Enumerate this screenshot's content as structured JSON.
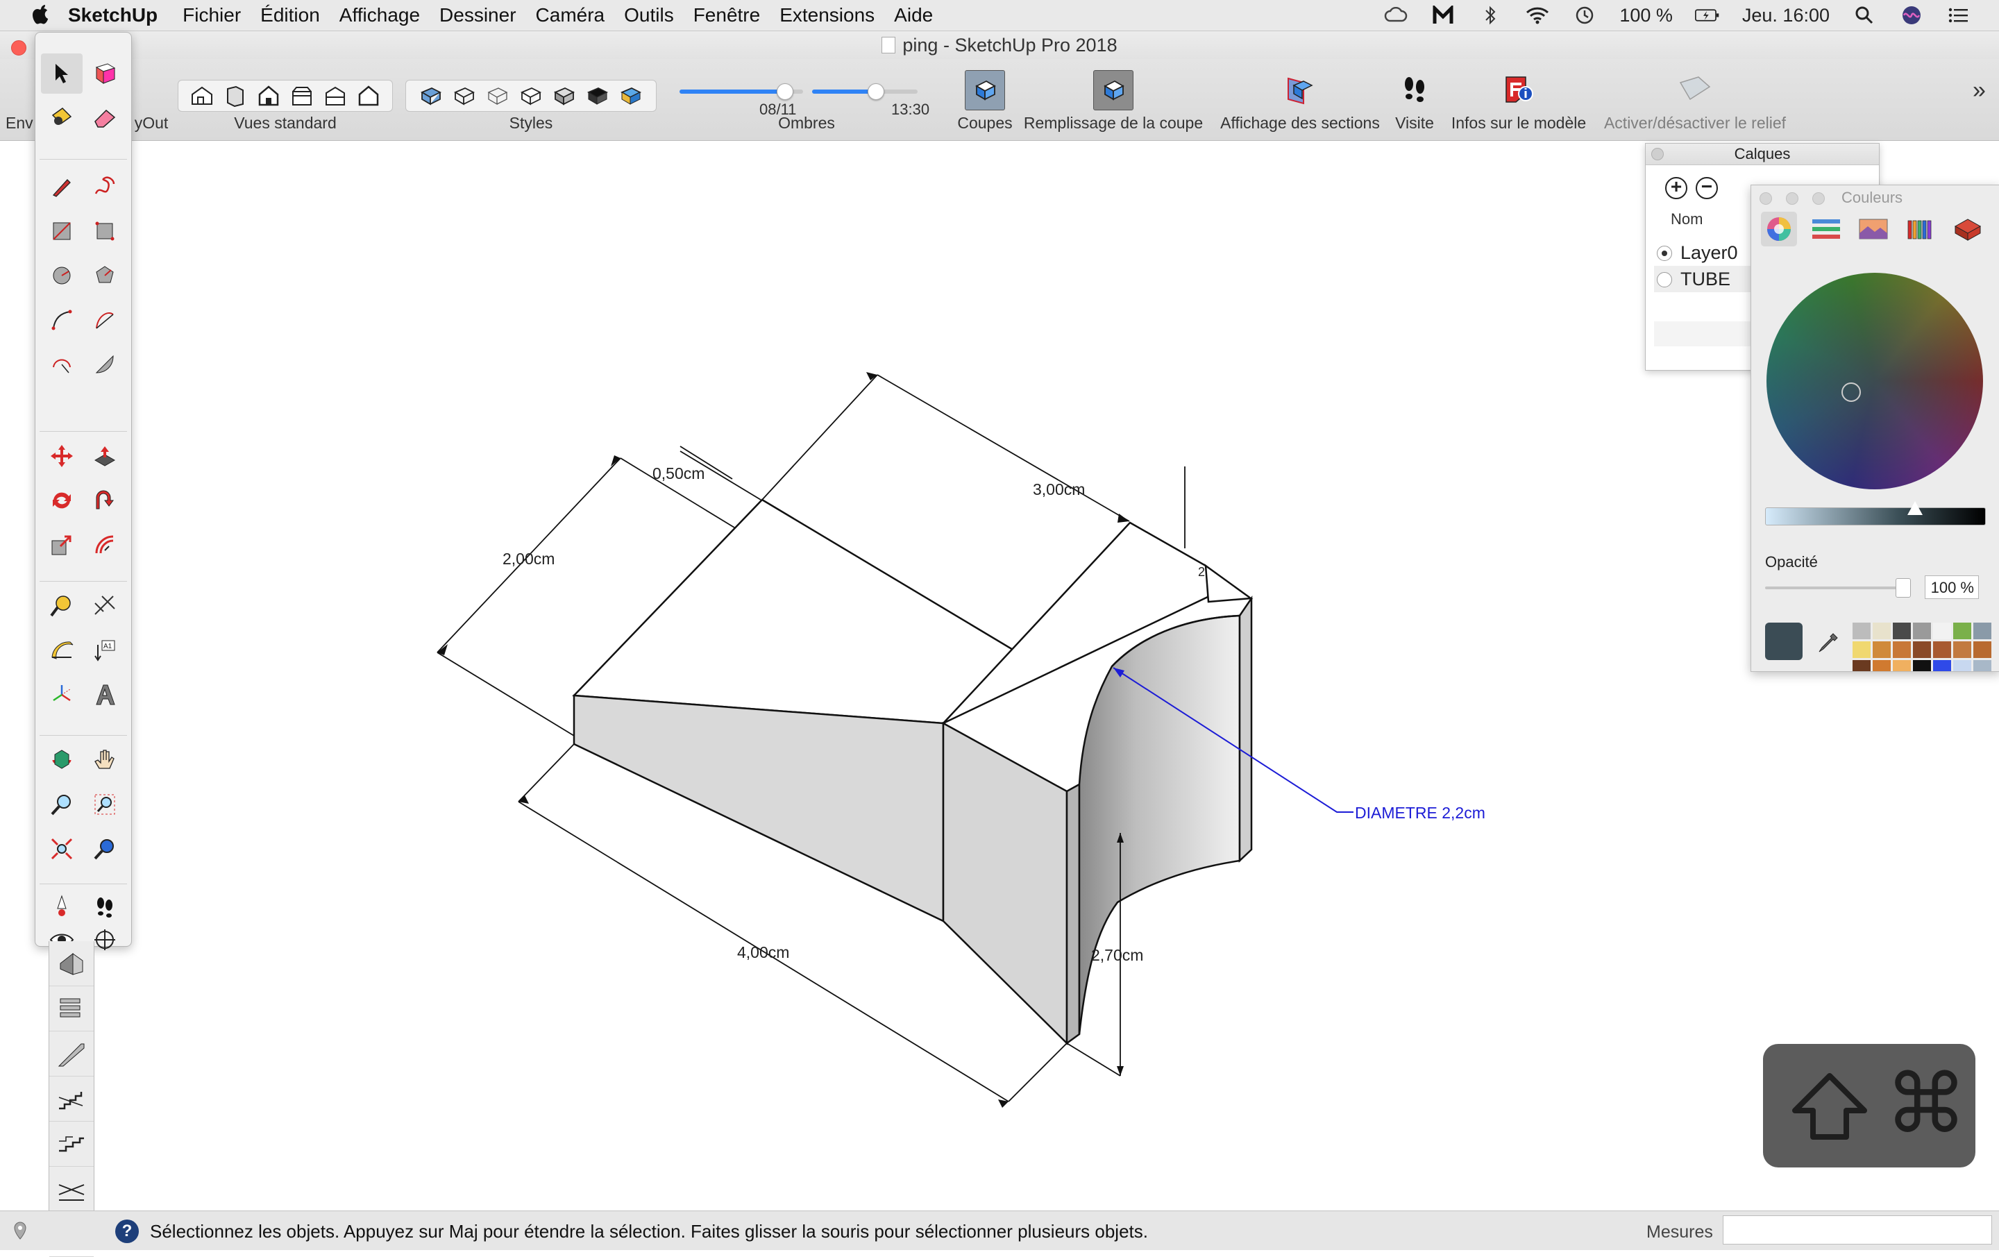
{
  "menubar": {
    "app_name": "SketchUp",
    "items": [
      "Fichier",
      "Édition",
      "Affichage",
      "Dessiner",
      "Caméra",
      "Outils",
      "Fenêtre",
      "Extensions",
      "Aide"
    ],
    "battery": "100 %",
    "clock": "Jeu. 16:00"
  },
  "window": {
    "title": "ping - SketchUp Pro 2018"
  },
  "toolbar": {
    "left_cut_label": "Env",
    "layout_cut_label": "yOut",
    "standard_views_label": "Vues standard",
    "styles_label": "Styles",
    "shadows_label": "Ombres",
    "shadow_date": "08/11",
    "shadow_time": "13:30",
    "shadow_date_level": 0.85,
    "shadow_time_level": 0.6,
    "sections_label": "Coupes",
    "section_fill_label": "Remplissage de la coupe",
    "section_display_label": "Affichage des sections",
    "tour_label": "Visite",
    "model_info_label": "Infos sur le modèle",
    "terrain_label": "Activer/désactiver le relief",
    "overflow": "»"
  },
  "drawing": {
    "dims": {
      "d_050": "0,50cm",
      "d_200": "2,00cm",
      "d_300": "3,00cm",
      "d_400": "4,00cm",
      "d_270": "2,70cm",
      "d_2": "2",
      "diameter": "DIAMETRE 2,2cm"
    },
    "colors": {
      "line": "#111111",
      "face_top": "#ffffff",
      "face_side": "#dcdcdc",
      "face_dark": "#bdbdbd",
      "leader": "#1c1cd6"
    }
  },
  "layers_panel": {
    "title": "Calques",
    "column_name": "Nom",
    "layers": [
      {
        "name": "Layer0",
        "active": true
      },
      {
        "name": "TUBE",
        "active": false
      }
    ]
  },
  "colors_panel": {
    "title": "Couleurs",
    "opacity_label": "Opacité",
    "opacity_value": "100 %",
    "current_color": "#3b4c55",
    "swatches": [
      "#bcbcbc",
      "#e8e2cc",
      "#4a4a4a",
      "#9a9a9a",
      "#f2f2f2",
      "#7ab04a",
      "#8a9aa8",
      "#f0d870",
      "#d08a3a",
      "#c87838",
      "#8a4a28",
      "#a85a30",
      "#c27a40",
      "#b86a30",
      "#6a3a20",
      "#d07a30",
      "#f0b060",
      "#111111",
      "#2f4ae8",
      "#c8d8f0",
      "#a8b8c8"
    ]
  },
  "overlay": {
    "shift_key": "⇧",
    "cmd_key": "⌘"
  },
  "statusbar": {
    "help": "?",
    "message": "Sélectionnez les objets. Appuyez sur Maj pour étendre la sélection. Faites glisser la souris pour sélectionner plusieurs objets.",
    "measures_label": "Mesures",
    "measures_value": ""
  }
}
